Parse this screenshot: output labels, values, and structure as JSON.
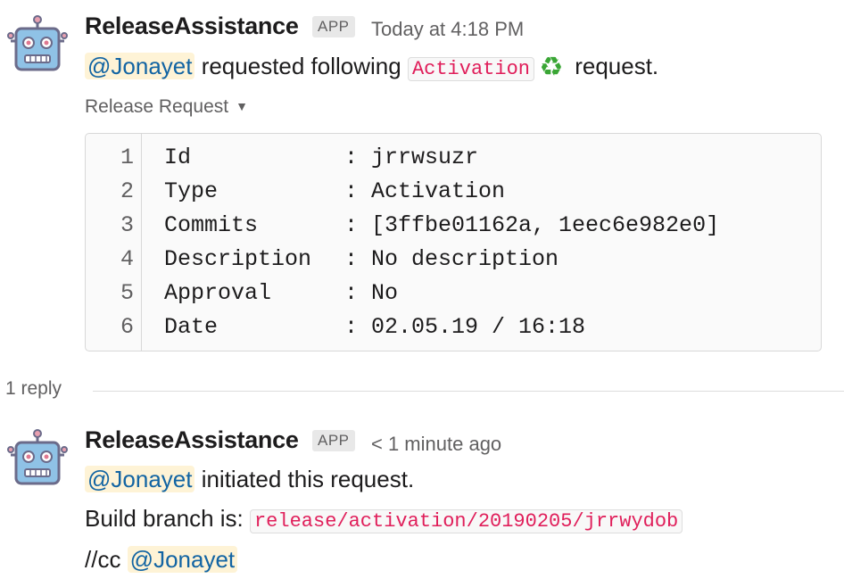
{
  "messages": [
    {
      "sender": "ReleaseAssistance",
      "badge": "APP",
      "time": "Today at 4:18 PM",
      "mention": "@Jonayet",
      "text_a": " requested following ",
      "code": "Activation",
      "emoji_icon": "recycle-icon",
      "text_b": " request."
    },
    {
      "sender": "ReleaseAssistance",
      "badge": "APP",
      "time": "< 1 minute ago",
      "line1_mention": "@Jonayet",
      "line1_text": " initiated this request.",
      "line2_text": "Build branch is: ",
      "line2_code": "release/activation/20190205/jrrwydob",
      "line3_text": "//cc ",
      "line3_mention": "@Jonayet"
    }
  ],
  "attachment": {
    "title": "Release Request",
    "rows": [
      {
        "n": "1",
        "key": "Id",
        "value": ": jrrwsuzr"
      },
      {
        "n": "2",
        "key": "Type",
        "value": ": Activation"
      },
      {
        "n": "3",
        "key": "Commits",
        "value": ": [3ffbe01162a, 1eec6e982e0]"
      },
      {
        "n": "4",
        "key": "Description",
        "value": ": No description"
      },
      {
        "n": "5",
        "key": "Approval",
        "value": ": No"
      },
      {
        "n": "6",
        "key": "Date",
        "value": ": 02.05.19 / 16:18"
      }
    ]
  },
  "thread": {
    "reply_count": "1 reply"
  },
  "colors": {
    "mention_bg": "#fef3d6",
    "mention_fg": "#1264a3",
    "code_fg": "#e01e5a",
    "robot_blue": "#8fc2e6"
  }
}
